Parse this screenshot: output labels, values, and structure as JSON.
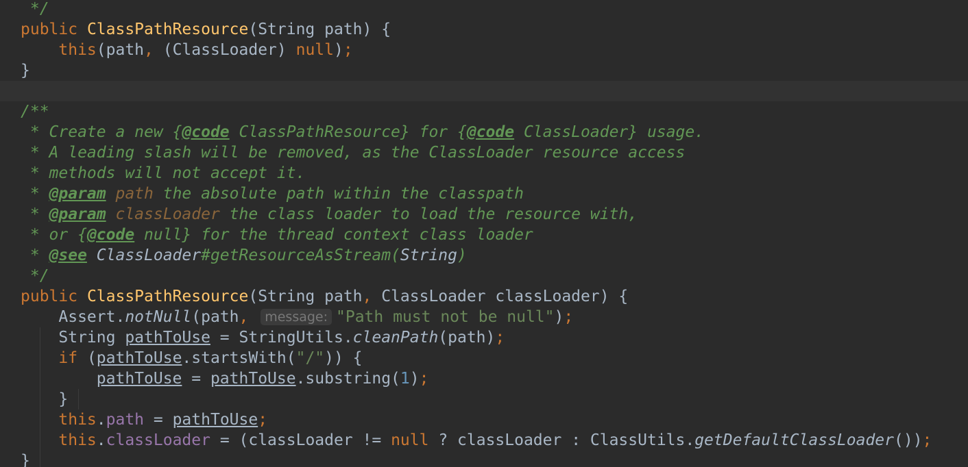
{
  "editor": {
    "lines": [
      {
        "segments": [
          {
            "text": " */",
            "cls": "doc"
          }
        ]
      },
      {
        "segments": [
          {
            "text": "public ",
            "cls": "kw"
          },
          {
            "text": "ClassPathResource",
            "cls": "fn"
          },
          {
            "text": "(String path) {",
            "cls": ""
          }
        ]
      },
      {
        "segments": [
          {
            "text": "    ",
            "cls": ""
          },
          {
            "text": "this",
            "cls": "kw"
          },
          {
            "text": "(path",
            "cls": ""
          },
          {
            "text": ", ",
            "cls": "kw"
          },
          {
            "text": "(ClassLoader) ",
            "cls": ""
          },
          {
            "text": "null",
            "cls": "kw"
          },
          {
            "text": ")",
            "cls": ""
          },
          {
            "text": ";",
            "cls": "kw"
          }
        ]
      },
      {
        "segments": [
          {
            "text": "}",
            "cls": ""
          }
        ]
      },
      {
        "segments": [],
        "current": true
      },
      {
        "segments": [
          {
            "text": "/**",
            "cls": "doc"
          }
        ]
      },
      {
        "segments": [
          {
            "text": " * Create a new {",
            "cls": "doc"
          },
          {
            "text": "@code",
            "cls": "doctag"
          },
          {
            "text": " ClassPathResource} for {",
            "cls": "doc"
          },
          {
            "text": "@code",
            "cls": "doctag"
          },
          {
            "text": " ClassLoader} usage.",
            "cls": "doc"
          }
        ]
      },
      {
        "segments": [
          {
            "text": " * A leading slash will be removed, as the ClassLoader resource access",
            "cls": "doc"
          }
        ]
      },
      {
        "segments": [
          {
            "text": " * methods will not accept it.",
            "cls": "doc"
          }
        ]
      },
      {
        "segments": [
          {
            "text": " * ",
            "cls": "doc"
          },
          {
            "text": "@param",
            "cls": "doctag"
          },
          {
            "text": " path",
            "cls": "docparam"
          },
          {
            "text": " the absolute path within the classpath",
            "cls": "doc"
          }
        ]
      },
      {
        "segments": [
          {
            "text": " * ",
            "cls": "doc"
          },
          {
            "text": "@param",
            "cls": "doctag"
          },
          {
            "text": " classLoader",
            "cls": "docparam"
          },
          {
            "text": " the class loader to load the resource with,",
            "cls": "doc"
          }
        ]
      },
      {
        "segments": [
          {
            "text": " * or {",
            "cls": "doc"
          },
          {
            "text": "@code",
            "cls": "doctag"
          },
          {
            "text": " null} for the thread context class loader",
            "cls": "doc"
          }
        ]
      },
      {
        "segments": [
          {
            "text": " * ",
            "cls": "doc"
          },
          {
            "text": "@see",
            "cls": "doctag"
          },
          {
            "text": " ClassLoader",
            "cls": "docref"
          },
          {
            "text": "#getResourceAsStream(",
            "cls": "doc"
          },
          {
            "text": "String",
            "cls": "docref"
          },
          {
            "text": ")",
            "cls": "doc"
          }
        ]
      },
      {
        "segments": [
          {
            "text": " */",
            "cls": "doc"
          }
        ]
      },
      {
        "segments": [
          {
            "text": "public ",
            "cls": "kw"
          },
          {
            "text": "ClassPathResource",
            "cls": "fn"
          },
          {
            "text": "(String path",
            "cls": ""
          },
          {
            "text": ", ",
            "cls": "kw"
          },
          {
            "text": "ClassLoader classLoader) {",
            "cls": ""
          }
        ]
      },
      {
        "segments": [
          {
            "text": "    Assert.",
            "cls": ""
          },
          {
            "text": "notNull",
            "cls": "ital"
          },
          {
            "text": "(path",
            "cls": ""
          },
          {
            "text": ", ",
            "cls": "kw"
          },
          {
            "text": "message:",
            "cls": "hint"
          },
          {
            "text": "\"Path must not be null\"",
            "cls": "str"
          },
          {
            "text": ")",
            "cls": ""
          },
          {
            "text": ";",
            "cls": "kw"
          }
        ]
      },
      {
        "segments": [
          {
            "text": "    String ",
            "cls": ""
          },
          {
            "text": "pathToUse",
            "cls": "ul"
          },
          {
            "text": " = StringUtils.",
            "cls": ""
          },
          {
            "text": "cleanPath",
            "cls": "ital"
          },
          {
            "text": "(path)",
            "cls": ""
          },
          {
            "text": ";",
            "cls": "kw"
          }
        ]
      },
      {
        "segments": [
          {
            "text": "    ",
            "cls": ""
          },
          {
            "text": "if ",
            "cls": "kw"
          },
          {
            "text": "(",
            "cls": ""
          },
          {
            "text": "pathToUse",
            "cls": "ul"
          },
          {
            "text": ".startsWith(",
            "cls": ""
          },
          {
            "text": "\"/\"",
            "cls": "str"
          },
          {
            "text": ")) {",
            "cls": ""
          }
        ]
      },
      {
        "segments": [
          {
            "text": "        ",
            "cls": ""
          },
          {
            "text": "pathToUse",
            "cls": "ul"
          },
          {
            "text": " = ",
            "cls": ""
          },
          {
            "text": "pathToUse",
            "cls": "ul"
          },
          {
            "text": ".substring(",
            "cls": ""
          },
          {
            "text": "1",
            "cls": "num"
          },
          {
            "text": ")",
            "cls": ""
          },
          {
            "text": ";",
            "cls": "kw"
          }
        ]
      },
      {
        "segments": [
          {
            "text": "    }",
            "cls": ""
          }
        ]
      },
      {
        "segments": [
          {
            "text": "    ",
            "cls": ""
          },
          {
            "text": "this",
            "cls": "kw"
          },
          {
            "text": ".",
            "cls": ""
          },
          {
            "text": "path",
            "cls": "fld"
          },
          {
            "text": " = ",
            "cls": ""
          },
          {
            "text": "pathToUse",
            "cls": "ul"
          },
          {
            "text": ";",
            "cls": "kw"
          }
        ]
      },
      {
        "segments": [
          {
            "text": "    ",
            "cls": ""
          },
          {
            "text": "this",
            "cls": "kw"
          },
          {
            "text": ".",
            "cls": ""
          },
          {
            "text": "classLoader",
            "cls": "fld"
          },
          {
            "text": " = (classLoader != ",
            "cls": ""
          },
          {
            "text": "null ",
            "cls": "kw"
          },
          {
            "text": "? classLoader : ClassUtils.",
            "cls": ""
          },
          {
            "text": "getDefaultClassLoader",
            "cls": "ital"
          },
          {
            "text": "())",
            "cls": ""
          },
          {
            "text": ";",
            "cls": "kw"
          }
        ]
      },
      {
        "segments": [
          {
            "text": "}",
            "cls": ""
          }
        ]
      }
    ]
  },
  "colors": {
    "background": "#2b2b2b",
    "current_line": "#323232",
    "default_text": "#a9b7c6",
    "keyword": "#cc7832",
    "method_declaration": "#ffc66d",
    "string": "#6a8759",
    "number": "#6897bb",
    "field": "#9876aa",
    "doc_comment": "#629755",
    "doc_param": "#8a653b",
    "inlay_hint_bg": "#3b3b3b",
    "inlay_hint_text": "#787878"
  }
}
